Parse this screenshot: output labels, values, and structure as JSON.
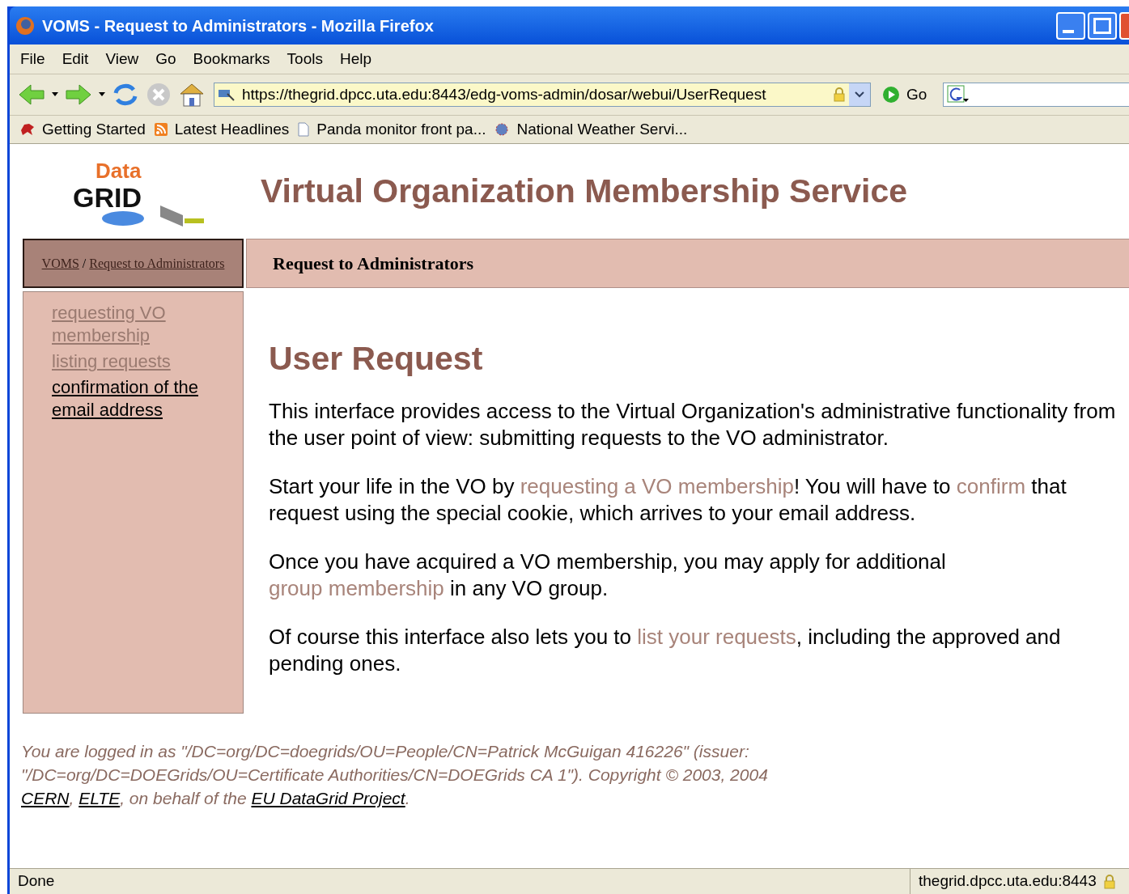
{
  "window": {
    "title": "VOMS - Request to Administrators - Mozilla Firefox"
  },
  "menu": [
    "File",
    "Edit",
    "View",
    "Go",
    "Bookmarks",
    "Tools",
    "Help"
  ],
  "toolbar": {
    "url": "https://thegrid.dpcc.uta.edu:8443/edg-voms-admin/dosar/webui/UserRequest",
    "go": "Go"
  },
  "bookmarks": [
    {
      "label": "Getting Started",
      "kind": "start"
    },
    {
      "label": "Latest Headlines",
      "kind": "rss"
    },
    {
      "label": "Panda monitor front pa...",
      "kind": "page"
    },
    {
      "label": "National Weather Servi...",
      "kind": "weather"
    }
  ],
  "logo": {
    "top": "Data",
    "bottom": "GRID"
  },
  "header": {
    "title": "Virtual Organization Membership Service"
  },
  "breadcrumb": [
    {
      "label": "VOMS"
    },
    {
      "label": "Request to Administrators"
    }
  ],
  "breadcrumb_separator": "/",
  "section_title": "Request to Administrators",
  "sidebar": {
    "items": [
      {
        "label": "requesting VO membership",
        "visited": true
      },
      {
        "label": "listing requests",
        "visited": true
      },
      {
        "label": "confirmation of the email address",
        "visited": false
      }
    ]
  },
  "content": {
    "heading": "User Request",
    "paragraphs": [
      [
        {
          "text": "This interface provides access to the Virtual Organization's administrative functionality from the user point of view: submitting requests to the VO administrator.",
          "link": false
        }
      ],
      [
        {
          "text": "Start your life in the VO by ",
          "link": false
        },
        {
          "text": "requesting a VO membership",
          "link": true
        },
        {
          "text": "! You will have to ",
          "link": false
        },
        {
          "text": "confirm",
          "link": true
        },
        {
          "text": " that request using the special cookie, which arrives to your email address.",
          "link": false
        }
      ],
      [
        {
          "text": "Once you have acquired a VO membership, you may apply for additional ",
          "link": false
        },
        {
          "text": "group membership",
          "link": true
        },
        {
          "text": " in any VO group.",
          "link": false
        }
      ],
      [
        {
          "text": "Of course this interface also lets you to ",
          "link": false
        },
        {
          "text": "list your requests",
          "link": true
        },
        {
          "text": ", including the approved and pending ones.",
          "link": false
        }
      ]
    ]
  },
  "footer": [
    {
      "text": "You are logged in as \"/DC=org/DC=doegrids/OU=People/CN=Patrick McGuigan 416226\" (issuer: \"/DC=org/DC=DOEGrids/OU=Certificate Authorities/CN=DOEGrids CA 1\"). Copyright © 2003, 2004 ",
      "link": false
    },
    {
      "text": "CERN",
      "link": true
    },
    {
      "text": ", ",
      "link": false
    },
    {
      "text": "ELTE",
      "link": true
    },
    {
      "text": ", on behalf of the ",
      "link": false
    },
    {
      "text": "EU DataGrid Project",
      "link": true
    },
    {
      "text": ".",
      "link": false
    }
  ],
  "status_bar": {
    "text": "Done",
    "host": "thegrid.dpcc.uta.edu:8443"
  }
}
